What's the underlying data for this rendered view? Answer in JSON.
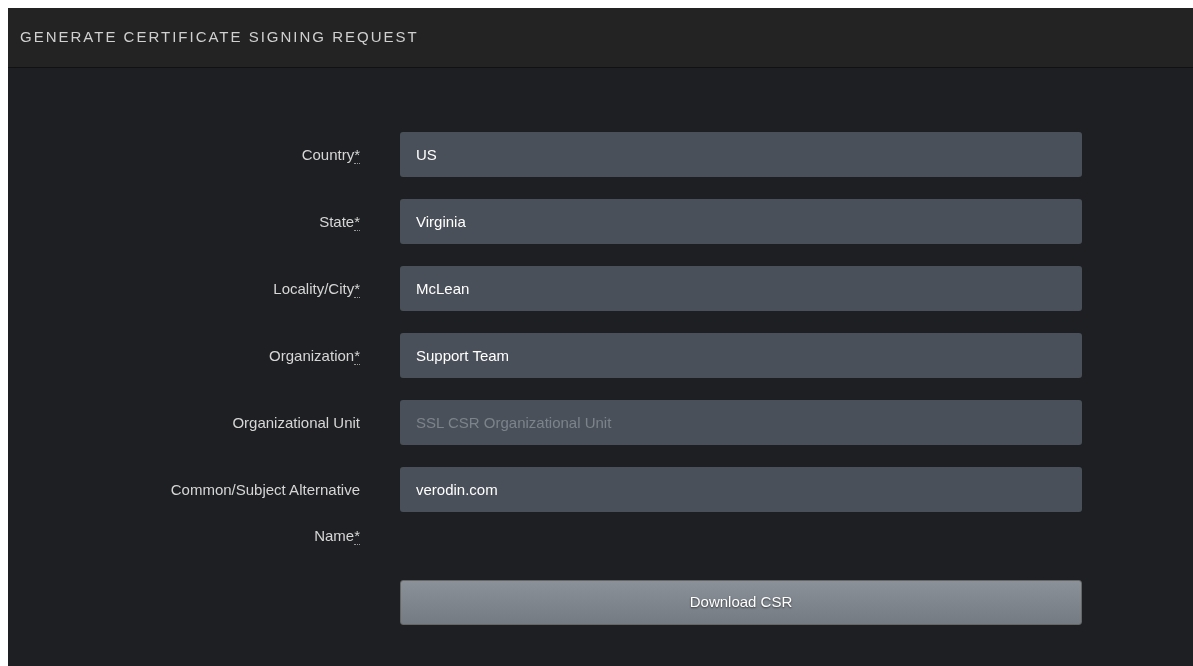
{
  "panel": {
    "title": "GENERATE CERTIFICATE SIGNING REQUEST"
  },
  "fields": [
    {
      "label": "Country",
      "required_mark": "*",
      "value": "US"
    },
    {
      "label": "State",
      "required_mark": "*",
      "value": "Virginia"
    },
    {
      "label": "Locality/City",
      "required_mark": "*",
      "value": "McLean"
    },
    {
      "label": "Organization",
      "required_mark": "*",
      "value": "Support Team"
    },
    {
      "label": "Organizational Unit",
      "placeholder": "SSL CSR Organizational Unit"
    },
    {
      "label": "Common/Subject Alternative Name",
      "required_mark": "*",
      "value": "verodin.com"
    }
  ],
  "submit_button": "Download CSR"
}
